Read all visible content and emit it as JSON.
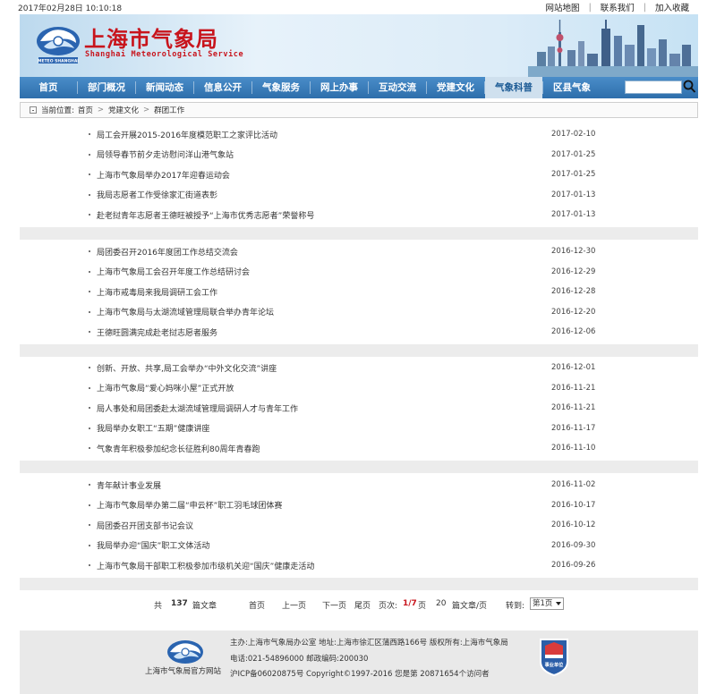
{
  "topbar": {
    "datetime": "2017年02月28日  10:10:18",
    "links": [
      "网站地图",
      "联系我们",
      "加入收藏"
    ]
  },
  "header": {
    "title_cn": "上海市气象局",
    "title_en": "Shanghai Meteorological Service",
    "emblem_text": "METEO SHANGHAI"
  },
  "nav": {
    "items": [
      "首页",
      "部门概况",
      "新闻动态",
      "信息公开",
      "气象服务",
      "网上办事",
      "互动交流",
      "党建文化",
      "气象科普",
      "区县气象"
    ],
    "active_index": 8
  },
  "breadcrumb": {
    "label": "当前位置:",
    "items": [
      "首页",
      "党建文化",
      "群团工作"
    ]
  },
  "groups": [
    [
      {
        "title": "局工会开展2015-2016年度模范职工之家评比活动",
        "date": "2017-02-10"
      },
      {
        "title": "局领导春节前夕走访慰问洋山港气象站",
        "date": "2017-01-25"
      },
      {
        "title": "上海市气象局举办2017年迎春运动会",
        "date": "2017-01-25"
      },
      {
        "title": "我局志愿者工作受徐家汇街道表彰",
        "date": "2017-01-13"
      },
      {
        "title": "赴老挝青年志愿者王德旺被授予“上海市优秀志愿者”荣誉称号",
        "date": "2017-01-13"
      }
    ],
    [
      {
        "title": "局团委召开2016年度团工作总结交流会",
        "date": "2016-12-30"
      },
      {
        "title": "上海市气象局工会召开年度工作总结研讨会",
        "date": "2016-12-29"
      },
      {
        "title": "上海市戒毒局来我局调研工会工作",
        "date": "2016-12-28"
      },
      {
        "title": "上海市气象局与太湖流域管理局联合举办青年论坛",
        "date": "2016-12-20"
      },
      {
        "title": "王德旺圆满完成赴老挝志愿者服务",
        "date": "2016-12-06"
      }
    ],
    [
      {
        "title": "创新、开放、共享,局工会举办“中外文化交流”讲座",
        "date": "2016-12-01"
      },
      {
        "title": "上海市气象局“爱心妈咪小屋”正式开放",
        "date": "2016-11-21"
      },
      {
        "title": "局人事处和局团委赴太湖流域管理局调研人才与青年工作",
        "date": "2016-11-21"
      },
      {
        "title": "我局举办女职工“五期”健康讲座",
        "date": "2016-11-17"
      },
      {
        "title": "气象青年积极参加纪念长征胜利80周年青春跑",
        "date": "2016-11-10"
      }
    ],
    [
      {
        "title": "青年献计事业发展",
        "date": "2016-11-02"
      },
      {
        "title": "上海市气象局举办第二届“申云杯”职工羽毛球团体赛",
        "date": "2016-10-17"
      },
      {
        "title": "局团委召开团支部书记会议",
        "date": "2016-10-12"
      },
      {
        "title": "我局举办迎“国庆”职工文体活动",
        "date": "2016-09-30"
      },
      {
        "title": "上海市气象局干部职工积极参加市级机关迎“国庆”健康走活动",
        "date": "2016-09-26"
      }
    ]
  ],
  "pager": {
    "total_prefix": "共",
    "total_count": "137",
    "total_suffix": "篇文章",
    "first": "首页",
    "prev": "上一页",
    "next": "下一页",
    "last": "尾页",
    "page_label": "页次:",
    "page_current": "1/7",
    "page_unit": "页",
    "per_page": "20",
    "per_page_suffix": "篇文章/页",
    "goto_label": "转到:",
    "goto_value": "第1页"
  },
  "footer": {
    "site_caption": "上海市气象局官方网站",
    "line1": "主办:上海市气象局办公室 地址:上海市徐汇区蒲西路166号 版权所有:上海市气象局",
    "line2": "电话:021-54896000 邮政编码:200030",
    "line3": "沪ICP备06020875号 Copyright©1997-2016 您是第 20871654个访问者",
    "badge_text": "事业单位"
  },
  "colors": {
    "brand_red": "#c8141c",
    "nav_blue": "#2d6eab",
    "nav_active_bg": "#cfe0ee"
  }
}
